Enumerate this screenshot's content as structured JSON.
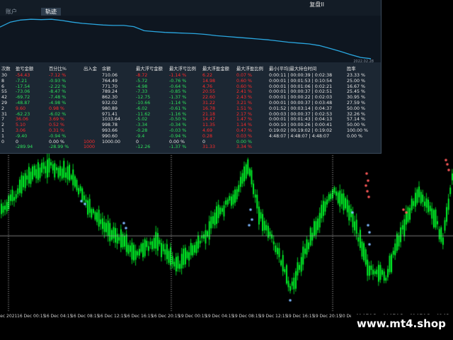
{
  "panel": {
    "tabs": [
      "",
      "账户",
      "轨迹"
    ],
    "active_tab": 2,
    "title": "复盘II",
    "balance_date": "2022.02.28",
    "balance_curve": [
      0.21,
      0.09,
      0.04,
      0.02,
      0.03,
      0.02,
      0.05,
      0.09,
      0.12,
      0.14,
      0.16,
      0.17,
      0.17,
      0.2,
      0.3,
      0.32,
      0.34,
      0.35,
      0.36,
      0.37,
      0.39,
      0.42,
      0.44,
      0.46,
      0.48,
      0.5,
      0.52,
      0.55,
      0.58,
      0.6,
      0.62,
      0.66,
      0.73,
      0.8,
      0.88,
      0.95,
      0.98
    ]
  },
  "stats": {
    "headers": [
      "次数",
      "盈亏金额",
      "百分比%",
      "出入金",
      "余额",
      "最大浮亏金额",
      "最大浮亏比例",
      "最大浮盈金额",
      "最大浮盈比例",
      "最小|平均|最大持仓时间",
      "胜率"
    ],
    "rows": [
      [
        "30",
        "-54.43",
        "-7.12 %",
        "",
        "710.06",
        "-8.72",
        "-1.14 %",
        "6.22",
        "0.07 %",
        "0:00:11 | 00:00:39 | 0:02:38",
        "23.33 %"
      ],
      [
        "8",
        "-7.21",
        "-0.93 %",
        "",
        "764.49",
        "-5.72",
        "-0.76 %",
        "14.98",
        "0.60 %",
        "0:00:01 | 00:01:53 | 0:10:54",
        "25.00 %"
      ],
      [
        "6",
        "-17.54",
        "-2.22 %",
        "",
        "771.70",
        "-4.98",
        "-0.64 %",
        "4.76",
        "0.60 %",
        "0:00:01 | 00:01:06 | 0:02:21",
        "16.67 %"
      ],
      [
        "55",
        "-73.06",
        "-8.47 %",
        "",
        "789.24",
        "-7.33",
        "-0.85 %",
        "20.55",
        "2.41 %",
        "0:00:01 | 00:00:37 | 0:02:51",
        "25.45 %"
      ],
      [
        "42",
        "-69.72",
        "-7.48 %",
        "",
        "862.30",
        "-12.75",
        "-1.37 %",
        "22.60",
        "2.43 %",
        "0:00:01 | 00:00:22 | 0:02:03",
        "30.95 %"
      ],
      [
        "29",
        "-48.87",
        "-4.98 %",
        "",
        "932.02",
        "-10.66",
        "-1.14 %",
        "31.22",
        "3.21 %",
        "0:00:01 | 00:00:37 | 0:03:48",
        "27.59 %"
      ],
      [
        "2",
        "9.60",
        "0.98 %",
        "",
        "980.89",
        "-6.02",
        "-0.61 %",
        "16.78",
        "1.51 %",
        "0:01:52 | 00:03:14 | 0:04:37",
        "50.00 %"
      ],
      [
        "31",
        "-62.23",
        "-6.02 %",
        "",
        "971.41",
        "-11.62",
        "-1.16 %",
        "21.18",
        "2.17 %",
        "0:00:03 | 00:00:37 | 0:02:53",
        "32.26 %"
      ],
      [
        "7",
        "36.06",
        "3.69 %",
        "",
        "1033.64",
        "-5.02",
        "-0.50 %",
        "14.47",
        "1.47 %",
        "0:00:01 | 00:01:43 | 0:04:13",
        "57.14 %"
      ],
      [
        "2",
        "5.10",
        "0.52 %",
        "",
        "998.78",
        "-3.34",
        "-0.34 %",
        "11.35",
        "1.14 %",
        "0:00:10 | 00:00:26 | 0:00:41",
        "50.00 %"
      ],
      [
        "1",
        "3.06",
        "0.31 %",
        "",
        "993.66",
        "-0.28",
        "-0.03 %",
        "4.69",
        "0.47 %",
        "0:19:02 | 00:19:02 | 0:19:02",
        "100.00 %"
      ],
      [
        "1",
        "-9.40",
        "-0.94 %",
        "",
        "990.60",
        "-9.4",
        "-0.94 %",
        "0.28",
        "0.03 %",
        "4:48:07 | 4:48:07 | 4:48:07",
        "0.00 %"
      ],
      [
        "0",
        "0",
        "0.00 %",
        "1000",
        "1000.00",
        "0",
        "0.00 %",
        "0",
        "0.00 %",
        "",
        ""
      ],
      [
        "",
        "-289.94",
        "-28.99 %",
        "1000",
        "",
        "-12.26",
        "-1.37 %",
        "31.33",
        "3.34 %",
        "",
        ""
      ]
    ],
    "row_colors": [
      [
        "w",
        "r",
        "r",
        "w",
        "w",
        "r",
        "r",
        "r",
        "r",
        "w",
        "w"
      ],
      [
        "w",
        "g",
        "g",
        "w",
        "w",
        "g",
        "g",
        "r",
        "r",
        "w",
        "w"
      ],
      [
        "w",
        "g",
        "g",
        "w",
        "w",
        "g",
        "g",
        "r",
        "r",
        "w",
        "w"
      ],
      [
        "w",
        "g",
        "g",
        "w",
        "w",
        "g",
        "g",
        "r",
        "r",
        "w",
        "w"
      ],
      [
        "w",
        "g",
        "g",
        "w",
        "w",
        "g",
        "g",
        "r",
        "r",
        "w",
        "w"
      ],
      [
        "w",
        "g",
        "g",
        "w",
        "w",
        "g",
        "g",
        "r",
        "r",
        "w",
        "w"
      ],
      [
        "w",
        "r",
        "r",
        "w",
        "w",
        "g",
        "g",
        "r",
        "r",
        "w",
        "w"
      ],
      [
        "w",
        "g",
        "g",
        "w",
        "w",
        "g",
        "g",
        "r",
        "r",
        "w",
        "w"
      ],
      [
        "w",
        "r",
        "r",
        "w",
        "w",
        "g",
        "g",
        "r",
        "r",
        "w",
        "w"
      ],
      [
        "w",
        "r",
        "r",
        "w",
        "w",
        "g",
        "g",
        "r",
        "r",
        "w",
        "w"
      ],
      [
        "w",
        "r",
        "r",
        "w",
        "w",
        "g",
        "g",
        "r",
        "r",
        "w",
        "w"
      ],
      [
        "w",
        "g",
        "g",
        "w",
        "w",
        "g",
        "g",
        "r",
        "r",
        "w",
        "w"
      ],
      [
        "w",
        "w",
        "w",
        "r",
        "w",
        "w",
        "w",
        "w",
        "g",
        "w",
        "w"
      ],
      [
        "w",
        "g",
        "g",
        "r",
        "w",
        "g",
        "g",
        "r",
        "r",
        "w",
        "w"
      ]
    ]
  },
  "chart": {
    "hline_level": 0.5,
    "time_labels": [
      "16 Dec 2021",
      "16 Dec 00:15",
      "16 Dec 04:15",
      "16 Dec 08:15",
      "16 Dec 12:15",
      "16 Dec 16:15",
      "16 Dec 20:15",
      "19 Dec 00:15",
      "19 Dec 04:15",
      "19 Dec 08:15",
      "19 Dec 12:15",
      "19 Dec 16:15",
      "19 Dec 20:15",
      "20 Dec 00:15",
      "20 Dec 04:15",
      "20 Dec 08:15",
      "20 Dec 12:15"
    ],
    "session_markers": 6,
    "colors": {
      "bull": "#00ff2a",
      "bear": "#00ff2a",
      "grid": "#ffffff",
      "hline": "#b0b0b0",
      "balance": "#2aa7e0"
    }
  },
  "brand": {
    "text": "www.mt4.shop"
  }
}
